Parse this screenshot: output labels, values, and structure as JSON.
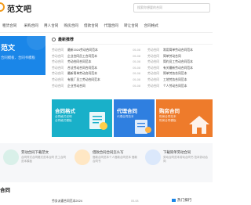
{
  "header": {
    "logo_text": "范文吧",
    "search_placeholder": "搜索你想要的合同"
  },
  "nav": [
    "租赁合同",
    "采购合同",
    "用人合同",
    "购房合同",
    "借款合同",
    "代理合同",
    "转让合同",
    "合同格式"
  ],
  "hero": {
    "title": "范文",
    "subtitle": "合同模板、合同书模板"
  },
  "recommend": {
    "title": "最新推荐",
    "left_rows": [
      {
        "tag": "劳动合同",
        "title": "最新2024劳动合同范本",
        "date": "05-08"
      },
      {
        "tag": "劳动合同",
        "title": "企业合同员工合同范本",
        "date": "05-08"
      },
      {
        "tag": "劳动合同",
        "title": "劳动合同合同范本",
        "date": "05-08"
      },
      {
        "tag": "劳动合同",
        "title": "合法劳动合同合同范本",
        "date": "05-08"
      },
      {
        "tag": "劳动合同",
        "title": "最新简单劳动合同范本",
        "date": "05-08"
      },
      {
        "tag": "劳动合同",
        "title": "有限厂员工劳动合同范本",
        "date": "05-08"
      },
      {
        "tag": "劳动合同",
        "title": "企业劳动合同",
        "date": "05-08"
      }
    ],
    "right_rows": [
      {
        "tag": "劳动合同",
        "title": "常用简单劳动合同范本"
      },
      {
        "tag": "劳动合同",
        "title": "简单劳动合同"
      },
      {
        "tag": "劳动合同",
        "title": "简约员工劳动合同范本"
      },
      {
        "tag": "劳动合同",
        "title": "有关最新劳动合同范本"
      },
      {
        "tag": "劳动合同",
        "title": "简单劳务合同范本"
      },
      {
        "tag": "劳动合同",
        "title": "工地劳务合同范本"
      },
      {
        "tag": "劳动合同",
        "title": "个人劳动合同范本"
      }
    ]
  },
  "cards": [
    {
      "title": "合同格式",
      "sub": "合同格式说明\n合同格式模板"
    },
    {
      "title": "代理合同",
      "sub": "代理合同范本"
    },
    {
      "title": "购房合同",
      "sub": "购房合同范本\n购房合同模板"
    }
  ],
  "mid": [
    {
      "title": "劳动合同下载范文",
      "sub": "合同样式合同格式范本合同 员工合同范本模板"
    },
    {
      "title": "借款合同合同怎么写",
      "sub": "借款合同范本个人借款合同范本 借款合同书"
    },
    {
      "title": "下载简单劳动合同",
      "sub": "劳动合同范本劳动合同书 范本劳动合同"
    }
  ],
  "section_title": "合同",
  "bottom": {
    "title": "劳务派遣合同范本2024",
    "date": "05-08"
  },
  "hot": {
    "label": "热门排行"
  },
  "colors": {
    "brand_orange": "#f29a1a",
    "hero_blue": "#1a86e8",
    "card_teal": "#19b0c9",
    "card_blue": "#2f7fe0",
    "card_orange": "#ee7b2b"
  }
}
